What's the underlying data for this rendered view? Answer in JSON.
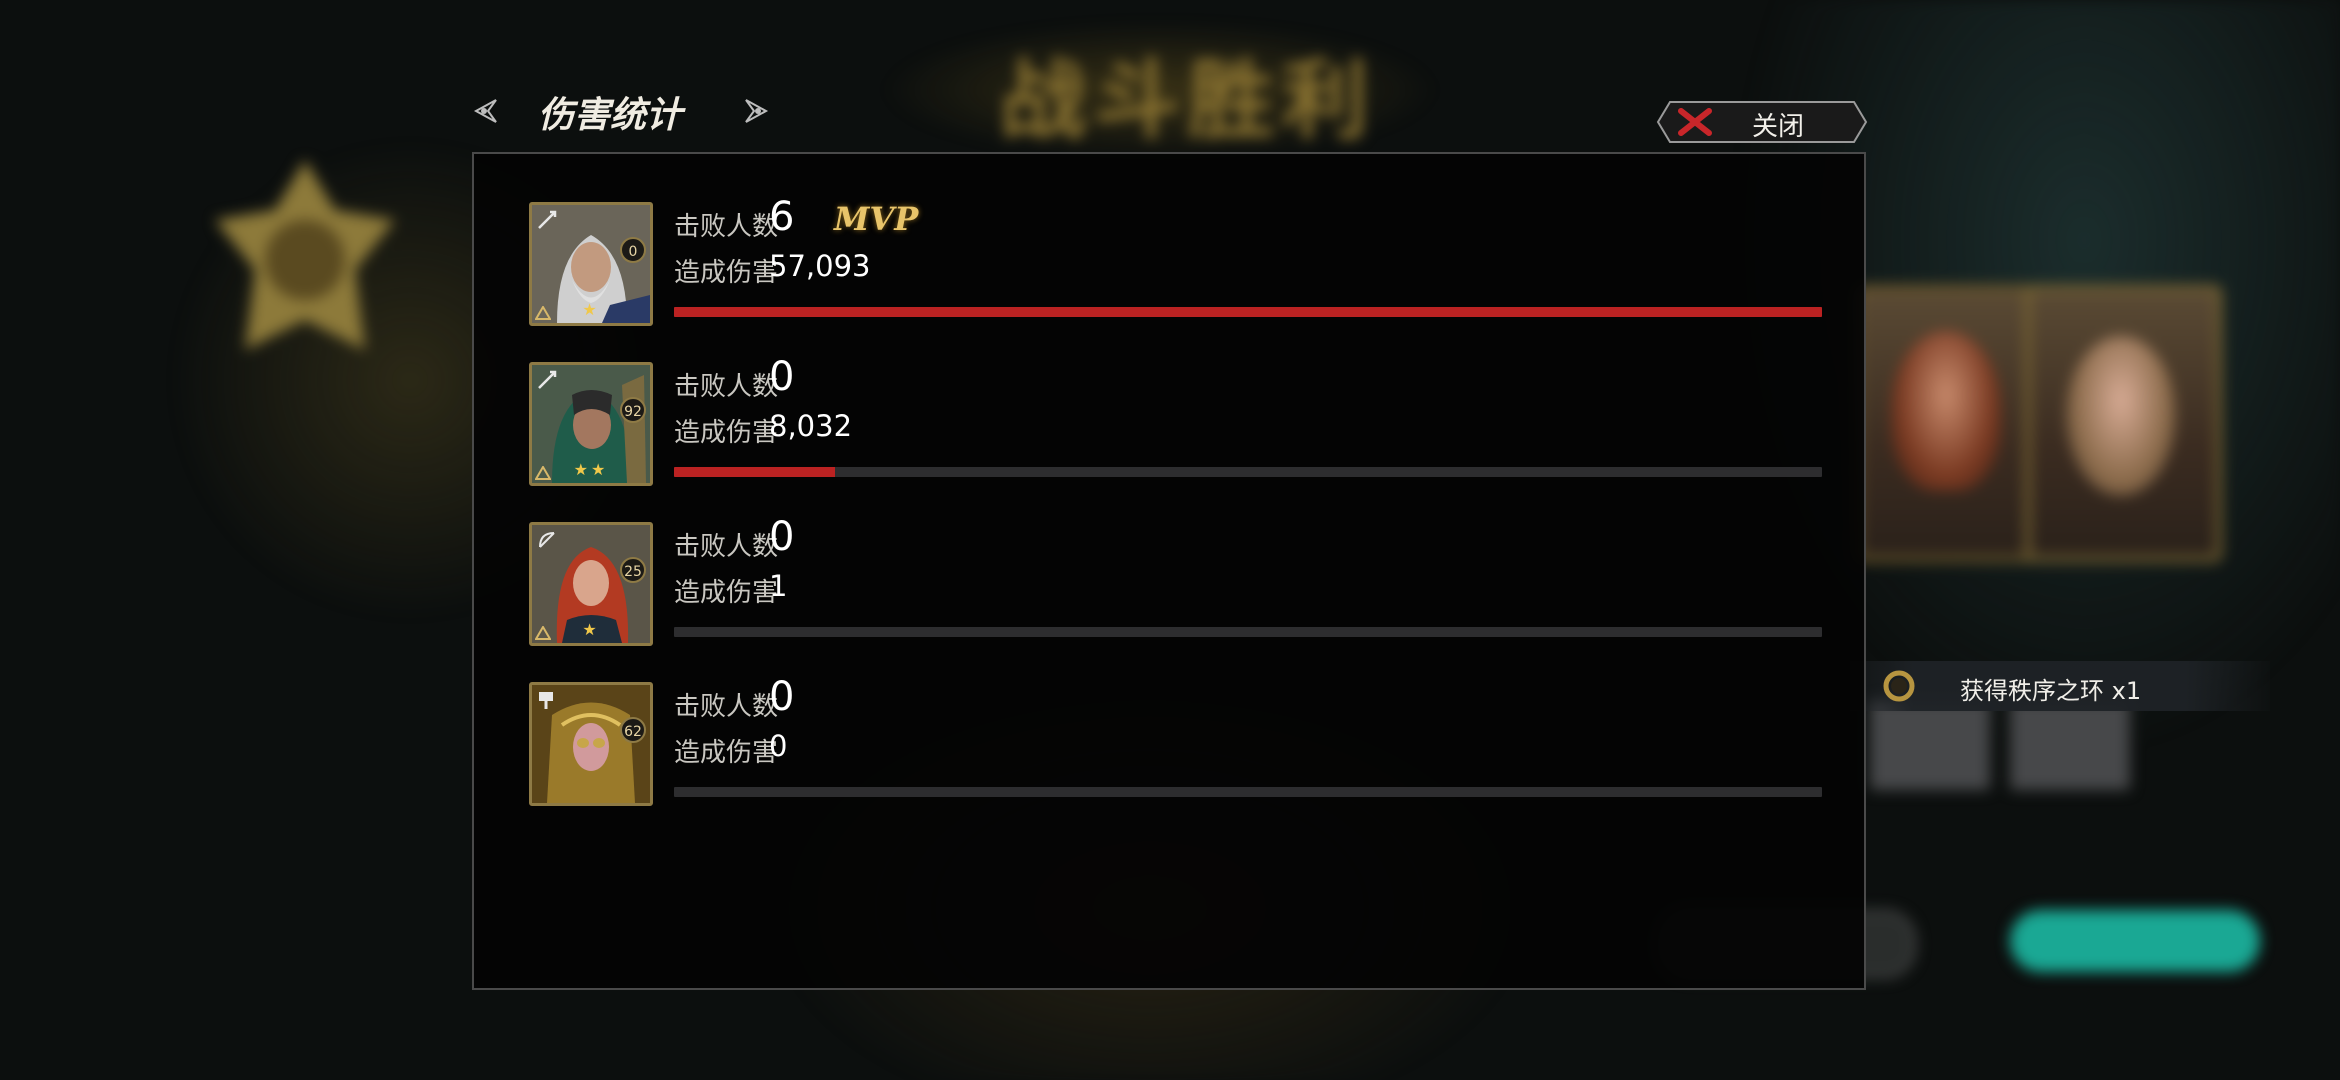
{
  "panel": {
    "title": "伤害统计",
    "close_label": "关闭"
  },
  "background": {
    "title": "战斗胜利"
  },
  "notification": {
    "text": "获得秩序之环  x1"
  },
  "labels": {
    "kills": "击败人数",
    "damage": "造成伤害"
  },
  "players": [
    {
      "level": "0",
      "stars": "★",
      "kills": "6",
      "damage": "57,093",
      "mvp": "MVP",
      "damage_fraction": 1.0,
      "weapon": "sword-icon"
    },
    {
      "level": "92",
      "stars": "★★",
      "kills": "0",
      "damage": "8,032",
      "mvp": "",
      "damage_fraction": 0.14,
      "weapon": "sword-icon"
    },
    {
      "level": "25",
      "stars": "★",
      "kills": "0",
      "damage": "1",
      "mvp": "",
      "damage_fraction": 0.0,
      "weapon": "bow-icon"
    },
    {
      "level": "62",
      "stars": "",
      "kills": "0",
      "damage": "0",
      "mvp": "",
      "damage_fraction": 0.0,
      "weapon": "hammer-icon"
    }
  ],
  "colors": {
    "damage_bar": "#bb2222",
    "bar_track": "#2d2d2f",
    "mvp": "#e8c46a",
    "frame": "#8e7a45"
  }
}
